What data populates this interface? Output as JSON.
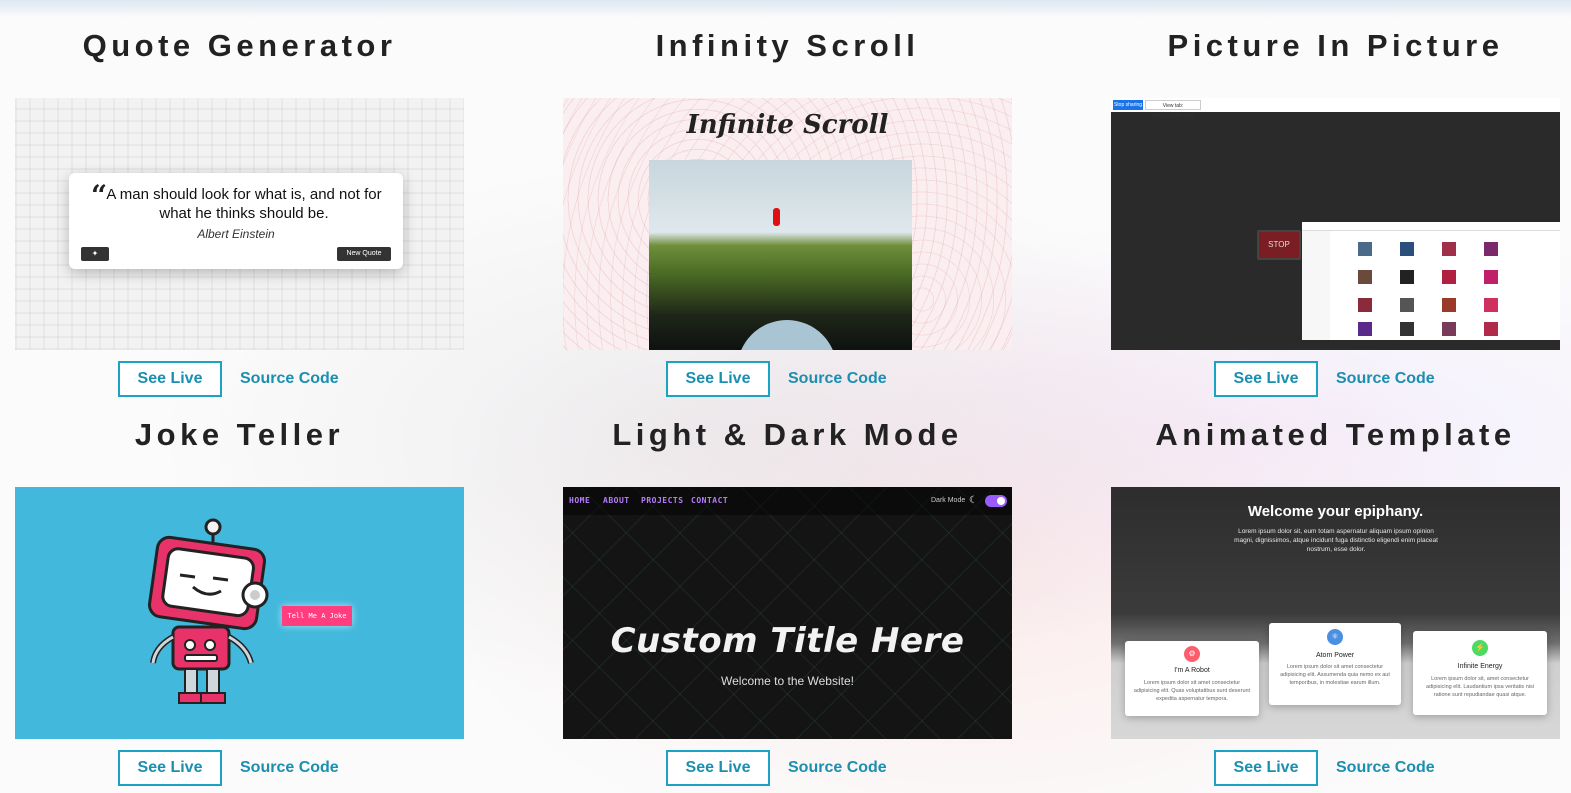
{
  "projects": [
    {
      "title": "Quote Generator",
      "see_live": "See Live",
      "source_code": "Source Code",
      "preview": {
        "quote": "A man should look for what is, and not for what he thinks should be.",
        "author": "Albert Einstein",
        "button": "New Quote"
      }
    },
    {
      "title": "Infinity Scroll",
      "see_live": "See Live",
      "source_code": "Source Code",
      "preview": {
        "heading": "Infinite Scroll"
      }
    },
    {
      "title": "Picture In Picture",
      "see_live": "See Live",
      "source_code": "Source Code",
      "preview": {
        "share_button": "Stop sharing",
        "tab_text": "View tab: www.youtube.com",
        "stop_button": "STOP"
      }
    },
    {
      "title": "Joke Teller",
      "see_live": "See Live",
      "source_code": "Source Code",
      "preview": {
        "button": "Tell Me A Joke"
      }
    },
    {
      "title": "Light & Dark Mode",
      "see_live": "See Live",
      "source_code": "Source Code",
      "preview": {
        "nav": [
          "HOME",
          "ABOUT",
          "PROJECTS",
          "CONTACT"
        ],
        "mode_label": "Dark Mode",
        "title": "Custom Title Here",
        "subtitle": "Welcome to the Website!"
      }
    },
    {
      "title": "Animated Template",
      "see_live": "See Live",
      "source_code": "Source Code",
      "preview": {
        "heading": "Welcome your epiphany.",
        "paragraph": "Lorem ipsum dolor sit, eum totam aspernatur aliquam ipsum opinion magni, dignissimos, atque incidunt fuga distinctio eligendi enim placeat nostrum, esse dolor.",
        "features": [
          {
            "title": "I'm A Robot",
            "text": "Lorem ipsum dolor sit amet consectetur adipisicing elit. Quas voluptatibus sunt deserunt expedita aspernatur tempora.",
            "color": "#ff5c6c"
          },
          {
            "title": "Atom Power",
            "text": "Lorem ipsum dolor sit amet consectetur adipisicing elit. Assumenda quia nemo ex aut temporibus, in molestiae earum illum.",
            "color": "#4a90e2"
          },
          {
            "title": "Infinite Energy",
            "text": "Lorem ipsum dolor sit, amet consectetur adipisicing elit. Laudantium ipsa veritatis nisi ratione sunt repudiandae quasi atque.",
            "color": "#4cd964"
          }
        ]
      }
    }
  ],
  "colors": {
    "accent": "#1aa3c4",
    "title": "#222222"
  }
}
